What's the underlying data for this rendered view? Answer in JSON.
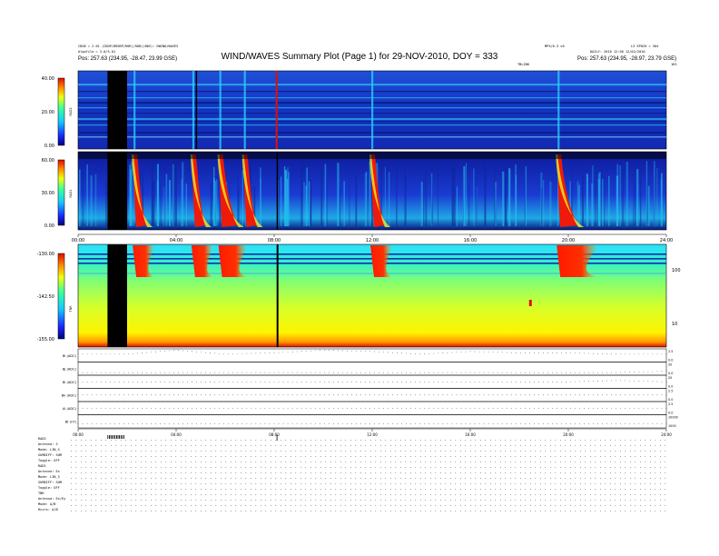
{
  "header": {
    "left_line1": "CDUD = 2.01 (CDDP/DRSBP/ROR)(ROB)(B0V): DWIND/WAVES",
    "left_line2": "Algofile = 3.0/5.01",
    "left_pos": "Pos: 257.63 (234.95, -28.47, 23.99 GSE)",
    "right_top1": "MP5/0.3 v0",
    "right_top2": "L3 EPOCH = 304",
    "right_line2": "DAILY: 2010 12:50 12/02/2010",
    "right_pos": "Pos: 257.63 (234.95, -28.97, 23.79 GSE)",
    "tick_note": "TBLINK",
    "top_right_mark": "1H3"
  },
  "title": "WIND/WAVES Summary Plot (Page 1) for 29-NOV-2010, DOY = 333",
  "colors": {
    "low": "#1836c6",
    "mid": "#2ad6ff",
    "high": "#ee1a0a",
    "black": "#000000"
  },
  "chart_data": [
    {
      "type": "heatmap",
      "panel": "RAD2",
      "ylabel": "RAD2",
      "ylim": [
        0,
        40
      ],
      "colorbar_ticks": [
        "40.00",
        "20.00",
        "0.00"
      ],
      "x_range": [
        0,
        24
      ],
      "bursts_hr": [
        2.3,
        4.7,
        5.8,
        6.8,
        12.0,
        19.6
      ],
      "data_gaps_hr": [
        [
          1.2,
          2.0
        ],
        [
          5.0,
          5.05
        ],
        [
          8.1,
          8.15
        ]
      ]
    },
    {
      "type": "heatmap",
      "panel": "RAD1",
      "ylabel": "RAD1",
      "ylim": [
        0,
        60
      ],
      "colorbar_ticks": [
        "60.00",
        "30.00",
        "0.00"
      ],
      "x_tick_labels": [
        "00:00",
        "04:00",
        "08:00",
        "12:00",
        "16:00",
        "20:00",
        "24:00"
      ],
      "x_range": [
        0,
        24
      ],
      "bursts_hr": [
        2.3,
        4.7,
        5.8,
        6.8,
        12.0,
        19.6
      ],
      "data_gaps_hr": [
        [
          1.2,
          2.0
        ],
        [
          8.1,
          8.15
        ]
      ]
    },
    {
      "type": "heatmap",
      "panel": "TNR",
      "ylabel": "TNR",
      "ylim": [
        -155,
        -130
      ],
      "colorbar_ticks": [
        "-130.00",
        "-142.50",
        "-155.00"
      ],
      "right_axis_ticks": [
        "100",
        "10"
      ],
      "x_range": [
        0,
        24
      ],
      "bursts_hr": [
        2.3,
        4.7,
        5.8,
        12.0,
        19.6
      ],
      "data_gaps_hr": [
        [
          1.2,
          2.0
        ],
        [
          8.1,
          8.15
        ]
      ]
    },
    {
      "type": "line",
      "panel": "spacecraft",
      "series": [
        {
          "name": "Bl (ADC)",
          "values": [
            0.6,
            0.6,
            0.9,
            0.6,
            0.7,
            0.9,
            0.8,
            0.6,
            0.8,
            0.7,
            0.7,
            0.6,
            0.6
          ]
        },
        {
          "name": "Bj (ADC)",
          "values": [
            0.2,
            0.2,
            0.2,
            0.2,
            0.2,
            0.2,
            0.2,
            0.2,
            0.2,
            0.2,
            0.2,
            0.2,
            0.3
          ]
        },
        {
          "name": "Bi (ADC)",
          "values": [
            0.5,
            0.5,
            0.5,
            0.5,
            0.5,
            0.5,
            0.5,
            0.5,
            0.5,
            0.5,
            0.5,
            0.6,
            0.5
          ]
        },
        {
          "name": "Bk (ADC)",
          "values": [
            0.5,
            0.5,
            0.5,
            0.5,
            0.5,
            0.5,
            0.5,
            0.5,
            0.5,
            0.5,
            0.5,
            0.5,
            0.5
          ]
        },
        {
          "name": "Al (ADC)",
          "values": [
            0.5,
            0.5,
            0.5,
            0.5,
            0.5,
            0.5,
            0.5,
            0.5,
            0.5,
            0.5,
            0.5,
            0.5,
            0.5
          ]
        },
        {
          "name": "Bt (nT)",
          "values": [
            0.3,
            0.3,
            0.3,
            0.3,
            0.3,
            0.3,
            0.3,
            0.3,
            0.3,
            0.3,
            0.3,
            0.3,
            0.3
          ]
        }
      ],
      "x_range": [
        0,
        24
      ],
      "x_tick_labels": [
        "00:00",
        "04:00",
        "08:00",
        "12:00",
        "16:00",
        "20:00",
        "24:00"
      ],
      "right_ticks": [
        [
          "2.5",
          "0.0"
        ],
        [
          "20",
          "0.0"
        ],
        [
          "20",
          "0.0"
        ],
        [
          "2.5",
          "0.0"
        ],
        [
          "2.5",
          "0.0"
        ],
        [
          "10000",
          "1000"
        ]
      ]
    }
  ],
  "status": {
    "rad2_block": [
      "RAD2",
      "Antenna: S",
      "Mode: LIN_S",
      "SUMDIFF: SUM",
      "Toggle: OFF"
    ],
    "rad1_block": [
      "RAD1",
      "Antenna: Ex",
      "Mode: LIN_S",
      "SUMDIFF: SUM",
      "Toggle: OFF"
    ],
    "tnr_block": [
      "TNR",
      "Antenna: Ex/Ey",
      "Mode: A/B",
      "Rcvrs: A/B"
    ]
  }
}
